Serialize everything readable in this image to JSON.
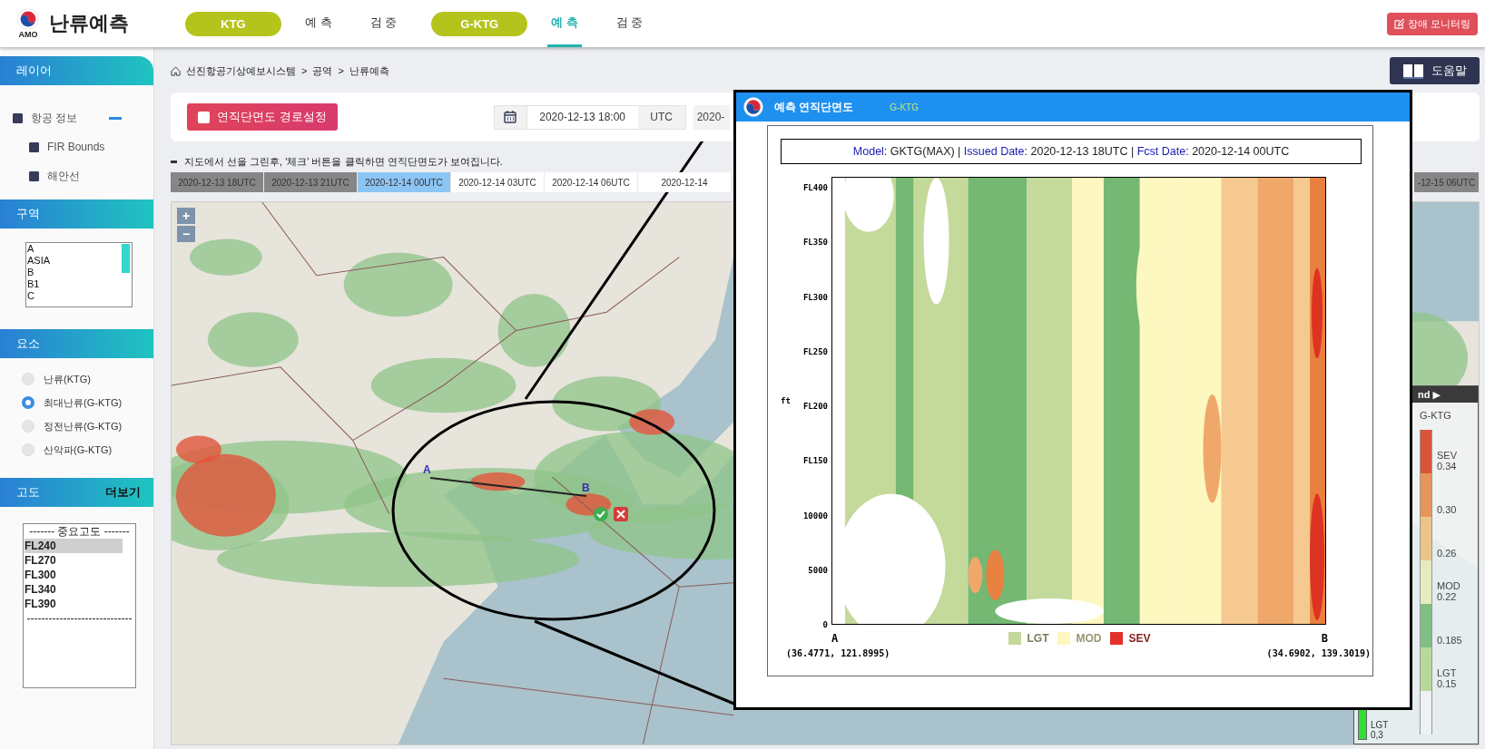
{
  "header": {
    "logo_text": "AMO",
    "title": "난류예측",
    "alert_button": "장애 모니터링",
    "nav": [
      {
        "kind": "group",
        "label": "KTG",
        "selected": false
      },
      {
        "kind": "link",
        "label": "예 측",
        "selected": false
      },
      {
        "kind": "link",
        "label": "검 중",
        "selected": false
      },
      {
        "kind": "group",
        "label": "G-KTG",
        "selected": false
      },
      {
        "kind": "link",
        "label": "예 측",
        "selected": true
      },
      {
        "kind": "link",
        "label": "검 중",
        "selected": false
      }
    ]
  },
  "sidebar": {
    "layers": {
      "title": "레이어",
      "groups": [
        {
          "label": "항공 정보",
          "checked": true,
          "expanded": true,
          "children": [
            {
              "label": "FIR Bounds",
              "checked": true
            },
            {
              "label": "해안선",
              "checked": true
            }
          ]
        }
      ]
    },
    "regions": {
      "title": "구역",
      "options": [
        "A",
        "ASIA",
        "B",
        "B1",
        "C"
      ]
    },
    "elements": {
      "title": "요소",
      "options": [
        {
          "label": "난류(KTG)",
          "selected": false
        },
        {
          "label": "최대난류(G-KTG)",
          "selected": true
        },
        {
          "label": "정전난류(G-KTG)",
          "selected": false
        },
        {
          "label": "산악파(G-KTG)",
          "selected": false
        }
      ]
    },
    "altitude": {
      "title": "고도",
      "more": "더보기",
      "options": [
        {
          "kind": "heading",
          "label": "------- 중요고도 -------",
          "selected": false
        },
        {
          "kind": "option",
          "label": "FL240",
          "selected": true
        },
        {
          "kind": "option",
          "label": "FL270",
          "selected": false
        },
        {
          "kind": "option",
          "label": "FL300",
          "selected": false
        },
        {
          "kind": "option",
          "label": "FL340",
          "selected": false
        },
        {
          "kind": "option",
          "label": "FL390",
          "selected": false
        },
        {
          "kind": "heading",
          "label": "-----------------------------",
          "selected": false
        }
      ]
    }
  },
  "breadcrumb": {
    "separator": ">",
    "items": [
      "선진항공기상예보시스템",
      "공역",
      "난류예측"
    ]
  },
  "help_button": "도움말",
  "toolbar": {
    "route_button": "연직단면도 경로설정",
    "route_checked": false,
    "date": "2020-12-13 18:00",
    "timezone": "UTC",
    "date_2": "2020-"
  },
  "note": "지도에서 선을 그린후, '체크' 버튼을 클릭하면 연직단면도가 보여집니다.",
  "time_tabs": [
    {
      "label": "2020-12-13 18UTC",
      "kind": "past",
      "selected": false
    },
    {
      "label": "2020-12-13 21UTC",
      "kind": "past",
      "selected": false
    },
    {
      "label": "2020-12-14 00UTC",
      "kind": "future",
      "selected": true
    },
    {
      "label": "2020-12-14 03UTC",
      "kind": "future",
      "selected": false
    },
    {
      "label": "2020-12-14 06UTC",
      "kind": "future",
      "selected": false
    },
    {
      "label": "2020-12-14",
      "kind": "future",
      "selected": false
    },
    {
      "label": "-12-15 06UTC",
      "kind": "past",
      "selected": false
    }
  ],
  "map": {
    "zoom_in": "+",
    "zoom_out": "−",
    "point_a": "A",
    "point_b": "B",
    "legend": {
      "header": "nd ▶",
      "title": "G-KTG",
      "extra": {
        "label": "LGT",
        "value": "0,3",
        "color": "#33dd33"
      },
      "scale": [
        {
          "label": "SEV",
          "value": "0.34",
          "color": "#d9553a"
        },
        {
          "value": "0.30",
          "color": "#e8955a"
        },
        {
          "value": "0.26",
          "color": "#ecc48a"
        },
        {
          "label": "MOD",
          "value": "0.22",
          "color": "#e6ecbf"
        },
        {
          "value": "0.185",
          "color": "#7fbf84"
        },
        {
          "label": "LGT",
          "value": "0.15",
          "color": "#b9d99b"
        },
        {
          "color": "#eef2f3"
        }
      ]
    }
  },
  "popup": {
    "title": "예측 연직단면도",
    "subtitle": "G-KTG",
    "chart_title": [
      {
        "kind": "label",
        "text": "Model"
      },
      {
        "kind": "value",
        "text": ": GKTG(MAX) | "
      },
      {
        "kind": "label",
        "text": "Issued Date"
      },
      {
        "kind": "value",
        "text": ": 2020-12-13 18UTC | "
      },
      {
        "kind": "label",
        "text": "Fcst Date"
      },
      {
        "kind": "value",
        "text": ": 2020-12-14 00UTC"
      }
    ],
    "y_label": "ft",
    "y_ticks": [
      "FL400",
      "FL350",
      "FL300",
      "FL250",
      "FL200",
      "FL150",
      "10000",
      "5000",
      "0"
    ],
    "start_label": "A",
    "end_label": "B",
    "start_coords": "(36.4771, 121.8995)",
    "end_coords": "(34.6902, 139.3019)",
    "legend": [
      {
        "label": "LGT",
        "color": "#c3d99a"
      },
      {
        "label": "MOD",
        "color": "#fff6c0"
      },
      {
        "label": "SEV",
        "color": "#e3302a"
      }
    ]
  }
}
